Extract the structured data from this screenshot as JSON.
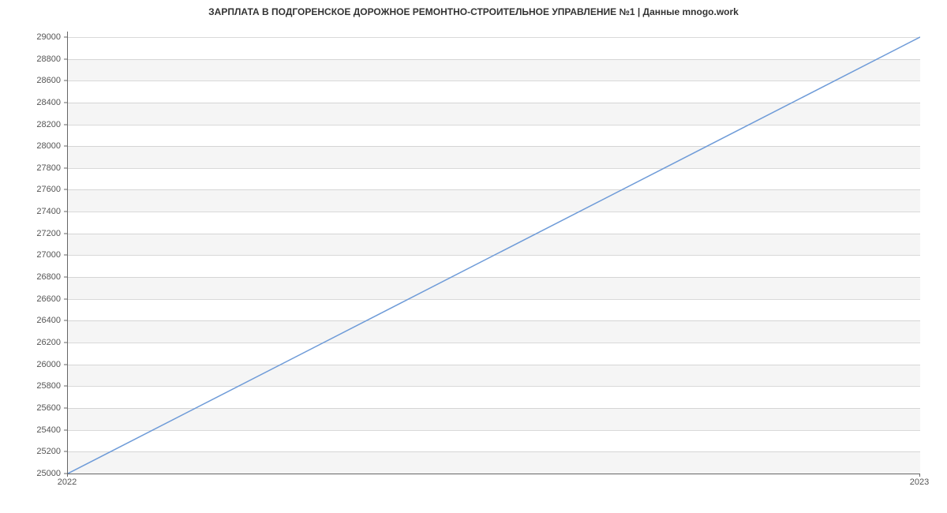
{
  "chart_data": {
    "type": "line",
    "title": "ЗАРПЛАТА В  ПОДГОРЕНСКОЕ ДОРОЖНОЕ РЕМОНТНО-СТРОИТЕЛЬНОЕ УПРАВЛЕНИЕ №1 | Данные mnogo.work",
    "xlabel": "",
    "ylabel": "",
    "x": [
      2022,
      2023
    ],
    "values": [
      25000,
      29000
    ],
    "x_ticks": [
      2022,
      2023
    ],
    "y_ticks": [
      25000,
      25200,
      25400,
      25600,
      25800,
      26000,
      26200,
      26400,
      26600,
      26800,
      27000,
      27200,
      27400,
      27600,
      27800,
      28000,
      28200,
      28400,
      28600,
      28800,
      29000
    ],
    "xlim": [
      2022,
      2023
    ],
    "ylim": [
      25000,
      29050
    ],
    "line_color": "#6e9bd8",
    "band_color": "#f5f5f5"
  }
}
